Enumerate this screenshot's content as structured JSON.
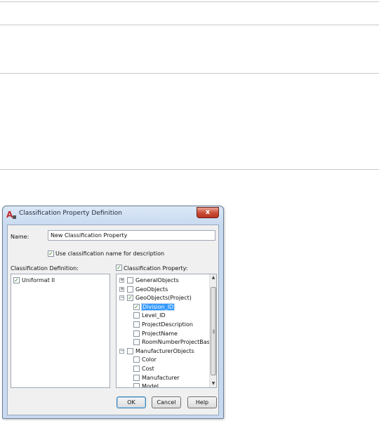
{
  "dialog": {
    "title": "Classification Property Definition",
    "close_glyph": "x",
    "name_label": "Name:",
    "name_value": "New Classification Property",
    "use_name_label": "Use classification name for description",
    "use_name_checked": true,
    "classification_definition_label": "Classification Definition:",
    "classification_definitions": [
      {
        "label": "Uniformat II",
        "checked": true
      }
    ],
    "classification_property_label": "Classification Property:",
    "classification_property_checked": true,
    "property_tree": [
      {
        "label": "GeneralObjects",
        "expander": "+",
        "checked": false
      },
      {
        "label": "GeoObjects",
        "expander": "+",
        "checked": false
      },
      {
        "label": "GeoObjects(Project)",
        "expander": "−",
        "checked": true
      },
      {
        "label": "Division_ID",
        "checked": true,
        "selected": true
      },
      {
        "label": "Level_ID",
        "checked": false
      },
      {
        "label": "ProjectDescription",
        "checked": false
      },
      {
        "label": "ProjectName",
        "checked": false
      },
      {
        "label": "RoomNumberProjectBased",
        "checked": false
      },
      {
        "label": "ManufacturerObjects",
        "expander": "−",
        "checked": false
      },
      {
        "label": "Color",
        "checked": false
      },
      {
        "label": "Cost",
        "checked": false
      },
      {
        "label": "Manufacturer",
        "checked": false
      },
      {
        "label": "Model",
        "checked": false
      }
    ],
    "buttons": {
      "ok": "OK",
      "cancel": "Cancel",
      "help": "Help"
    }
  },
  "icons": {
    "app": "autocad-app-icon",
    "close": "close-icon",
    "scroll_up": "scroll-up-arrow-icon",
    "scroll_down": "scroll-down-arrow-icon"
  }
}
